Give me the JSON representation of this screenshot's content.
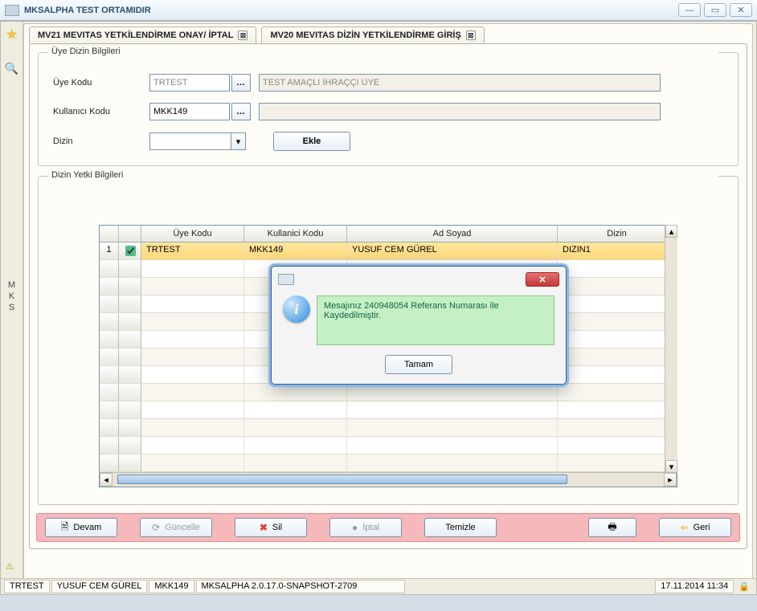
{
  "window": {
    "title": "MKSALPHA TEST ORTAMIDIR"
  },
  "tabs": [
    {
      "label": "MV21 MEVITAS YETKİLENDİRME ONAY/ İPTAL"
    },
    {
      "label": "MV20 MEVITAS DİZİN YETKİLENDİRME GİRİŞ"
    }
  ],
  "fieldset1": {
    "legend": "Üye Dizin Bilgileri",
    "uye_kodu_label": "Üye Kodu",
    "uye_kodu_value": "TRTEST",
    "uye_kodu_desc": "TEST AMAÇLI İHRAÇÇI ÜYE",
    "kullanici_label": "Kullanıcı Kodu",
    "kullanici_value": "MKK149",
    "kullanici_desc": "",
    "dizin_label": "Dizin",
    "dizin_value": "",
    "ekle_btn": "Ekle"
  },
  "fieldset2": {
    "legend": "Dizin Yetki Bilgileri"
  },
  "grid": {
    "headers": [
      "",
      "",
      "Üye Kodu",
      "Kullanici Kodu",
      "Ad Soyad",
      "Dizin"
    ],
    "rows": [
      {
        "n": "1",
        "checked": true,
        "uye": "TRTEST",
        "kul": "MKK149",
        "ad": "YUSUF CEM GÜREL",
        "dizin": "DIZIN1"
      }
    ]
  },
  "actions": {
    "devam": "Devam",
    "guncelle": "Güncelle",
    "sil": "Sil",
    "iptal": "İptal",
    "temizle": "Temizle",
    "geri": "Geri"
  },
  "status": {
    "c1": "TRTEST",
    "c2": "YUSUF CEM GÜREL",
    "c3": "MKK149",
    "c4": "MKSALPHA 2.0.17.0-SNAPSHOT-2709",
    "dt": "17.11.2014 11:34"
  },
  "modal": {
    "message": "Mesajınız 240948054 Referans Numarası ile Kaydedilmiştir.",
    "ok": "Tamam"
  },
  "sidebar": {
    "letters": "M\nK\nS"
  }
}
